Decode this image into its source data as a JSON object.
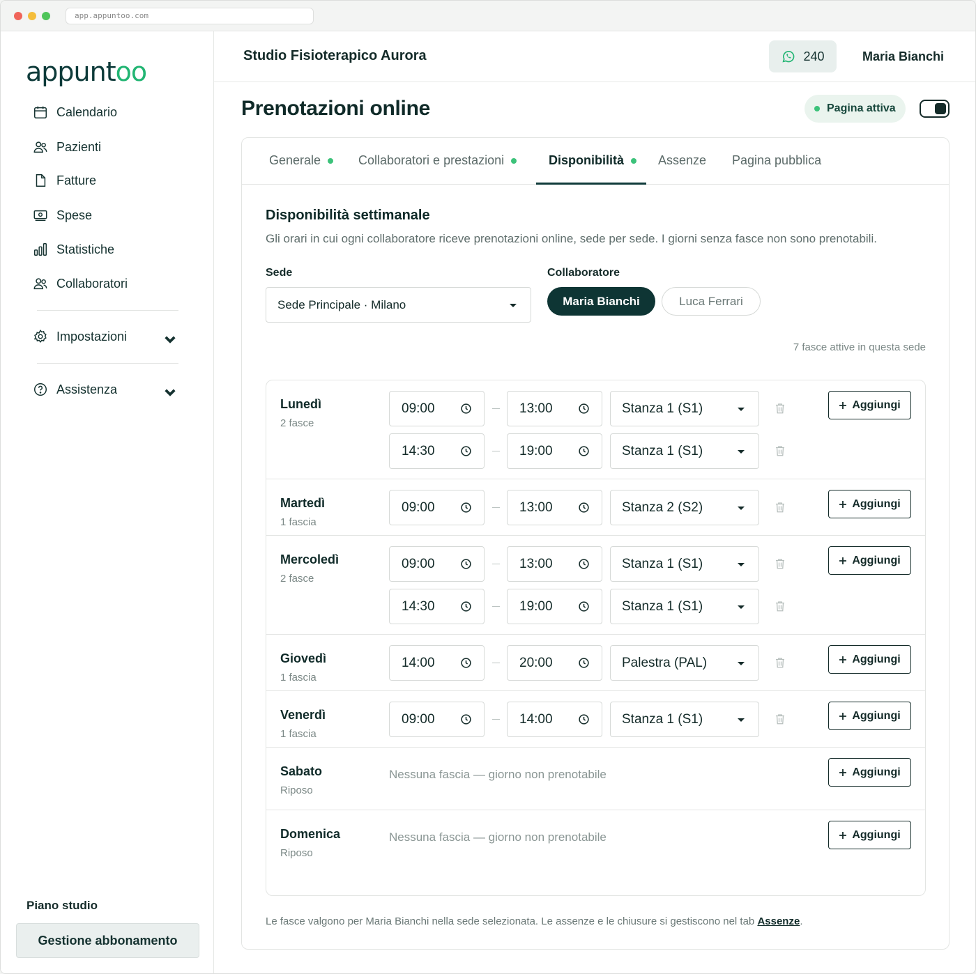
{
  "browser": {
    "url": "app.appuntoo.com"
  },
  "brand": {
    "logo_main": "appunt",
    "logo_accent": "oo",
    "accent_color": "#22b573",
    "dark_color": "#0e3534"
  },
  "sidebar": {
    "items": [
      {
        "label": "Calendario",
        "icon": "calendar-icon"
      },
      {
        "label": "Pazienti",
        "icon": "users-icon"
      },
      {
        "label": "Fatture",
        "icon": "document-icon"
      },
      {
        "label": "Spese",
        "icon": "cash-icon"
      },
      {
        "label": "Statistiche",
        "icon": "chart-icon"
      },
      {
        "label": "Collaboratori",
        "icon": "users-icon"
      }
    ],
    "settings": {
      "label": "Impostazioni",
      "icon": "gear-icon"
    },
    "help": {
      "label": "Assistenza",
      "icon": "help-icon"
    },
    "plan_title": "Piano studio",
    "plan_button": "Gestione abbonamento"
  },
  "header": {
    "studio_name": "Studio Fisioterapico Aurora",
    "whatsapp_count": "240",
    "user_name": "Maria Bianchi"
  },
  "page": {
    "title": "Prenotazioni online",
    "status_label": "Pagina attiva",
    "page_enabled": true
  },
  "tabs": [
    {
      "label": "Generale",
      "dot": true,
      "active": false
    },
    {
      "label": "Collaboratori e prestazioni",
      "dot": true,
      "active": false
    },
    {
      "label": "Disponibilità",
      "dot": true,
      "active": true
    },
    {
      "label": "Assenze",
      "dot": false,
      "active": false
    },
    {
      "label": "Pagina pubblica",
      "dot": false,
      "active": false
    }
  ],
  "availability": {
    "title": "Disponibilità settimanale",
    "description": "Gli orari in cui ogni collaboratore riceve prenotazioni online, sede per sede. I giorni senza fasce non sono prenotabili.",
    "sede_label": "Sede",
    "sede_value": "Sede Principale · Milano",
    "collab_label": "Collaboratore",
    "collaborators": [
      {
        "name": "Maria Bianchi",
        "selected": true
      },
      {
        "name": "Luca Ferrari",
        "selected": false
      }
    ],
    "active_count_text": "7 fasce attive in questa sede",
    "add_label": "Aggiungi",
    "empty_text": "Nessuna fascia — giorno non prenotabile",
    "days": [
      {
        "name": "Lunedì",
        "sub": "2 fasce",
        "slots": [
          {
            "start": "09:00",
            "end": "13:00",
            "room": "Stanza 1 (S1)"
          },
          {
            "start": "14:30",
            "end": "19:00",
            "room": "Stanza 1 (S1)"
          }
        ]
      },
      {
        "name": "Martedì",
        "sub": "1 fascia",
        "slots": [
          {
            "start": "09:00",
            "end": "13:00",
            "room": "Stanza 2 (S2)"
          }
        ]
      },
      {
        "name": "Mercoledì",
        "sub": "2 fasce",
        "slots": [
          {
            "start": "09:00",
            "end": "13:00",
            "room": "Stanza 1 (S1)"
          },
          {
            "start": "14:30",
            "end": "19:00",
            "room": "Stanza 1 (S1)"
          }
        ]
      },
      {
        "name": "Giovedì",
        "sub": "1 fascia",
        "slots": [
          {
            "start": "14:00",
            "end": "20:00",
            "room": "Palestra (PAL)"
          }
        ]
      },
      {
        "name": "Venerdì",
        "sub": "1 fascia",
        "slots": [
          {
            "start": "09:00",
            "end": "14:00",
            "room": "Stanza 1 (S1)"
          }
        ]
      },
      {
        "name": "Sabato",
        "sub": "Riposo",
        "slots": []
      },
      {
        "name": "Domenica",
        "sub": "Riposo",
        "slots": []
      }
    ],
    "footer_note": "Le fasce valgono per Maria Bianchi nella sede selezionata. Le assenze e le chiusure si gestiscono nel tab",
    "footer_link": "Assenze",
    "footer_end": "."
  }
}
